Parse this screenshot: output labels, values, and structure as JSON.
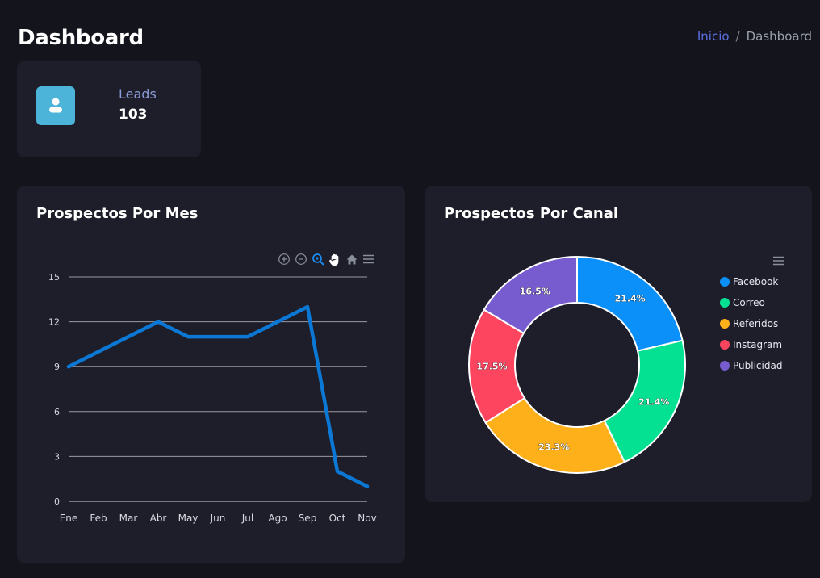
{
  "header": {
    "title": "Dashboard",
    "breadcrumb": {
      "home": "Inicio",
      "separator": "/",
      "current": "Dashboard"
    }
  },
  "stat_card": {
    "label": "Leads",
    "value": "103",
    "icon": "user-icon",
    "icon_color": "#4cb4d9"
  },
  "line_card": {
    "title": "Prospectos Por Mes",
    "toolbar": [
      "zoom-in-icon",
      "zoom-out-icon",
      "zoom-selection-icon",
      "pan-hand-icon",
      "home-reset-icon",
      "menu-icon"
    ]
  },
  "donut_card": {
    "title": "Prospectos Por Canal"
  },
  "chart_data": [
    {
      "type": "line",
      "title": "Prospectos Por Mes",
      "categories": [
        "Ene",
        "Feb",
        "Mar",
        "Abr",
        "May",
        "Jun",
        "Jul",
        "Ago",
        "Sep",
        "Oct",
        "Nov"
      ],
      "series": [
        {
          "values": [
            9,
            10,
            11,
            12,
            11,
            11,
            11,
            12,
            13,
            2,
            1
          ],
          "color": "#0a78d4"
        }
      ],
      "yticks": [
        "0",
        "3",
        "6",
        "9",
        "12",
        "15"
      ],
      "ylim": [
        0,
        15
      ],
      "grid": true
    },
    {
      "type": "pie",
      "title": "Prospectos Por Canal",
      "donut": true,
      "labels": [
        "Facebook",
        "Correo",
        "Referidos",
        "Instagram",
        "Publicidad"
      ],
      "values": [
        21.4,
        21.4,
        23.3,
        17.5,
        16.5
      ],
      "value_labels": [
        "21.4%",
        "21.4%",
        "23.3%",
        "17.5%",
        "16.5%"
      ],
      "colors": [
        "#0b8ff8",
        "#05e192",
        "#feb01a",
        "#fe4560",
        "#775cd0"
      ],
      "legend_position": "right"
    }
  ]
}
